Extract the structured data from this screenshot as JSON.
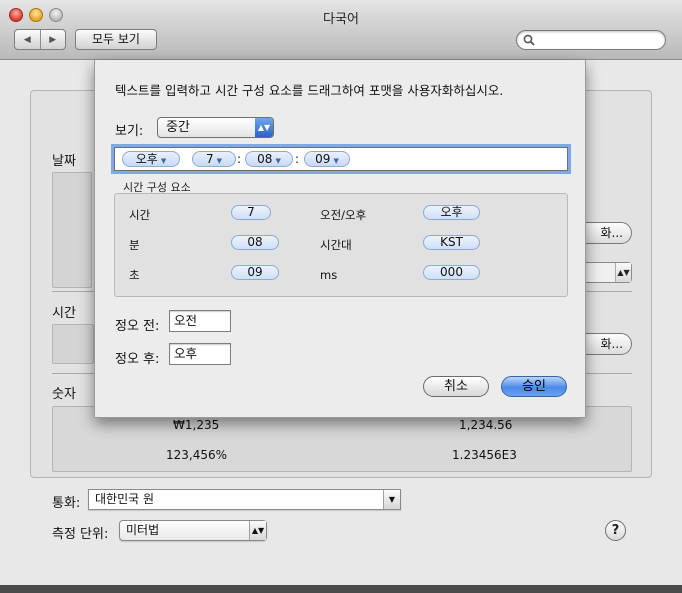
{
  "window": {
    "title": "다국어",
    "show_all": "모두 보기",
    "nav_back": "◀",
    "nav_forward": "▶",
    "search_placeholder": ""
  },
  "background": {
    "date_section": "날짜",
    "time_section": "시간",
    "number_section": "숫자",
    "numbers": {
      "currency_example": "₩1,235",
      "decimal_example": "1,234.56",
      "percent_example": "123,456%",
      "scientific_example": "1.23456E3"
    },
    "customize_button_partial": "화...",
    "currency_label": "통화:",
    "currency_value": "대한민국 원",
    "measure_label": "측정 단위:",
    "measure_value": "미터법",
    "help_label": "?"
  },
  "sheet": {
    "instruction": "텍스트를 입력하고 시간 구성 요소를 드래그하여 포맷을 사용자화하십시오.",
    "view_label": "보기:",
    "view_value": "중간",
    "format_tokens": [
      "오후",
      "7",
      "08",
      "09"
    ],
    "format_separators": [
      ":",
      ":"
    ],
    "components_title": "시간 구성 요소",
    "components": {
      "hour_label": "시간",
      "hour_value": "7",
      "minute_label": "분",
      "minute_value": "08",
      "second_label": "초",
      "second_value": "09",
      "ampm_label": "오전/오후",
      "ampm_value": "오후",
      "timezone_label": "시간대",
      "timezone_value": "KST",
      "ms_label": "ms",
      "ms_value": "000"
    },
    "am_label": "정오 전:",
    "am_value": "오전",
    "pm_label": "정오 후:",
    "pm_value": "오후",
    "cancel_button": "취소",
    "ok_button": "승인"
  },
  "colors": {
    "focus_ring": "#7fa9e6",
    "token_fill": "#c9daf5",
    "default_button": "#4a8ae8"
  }
}
